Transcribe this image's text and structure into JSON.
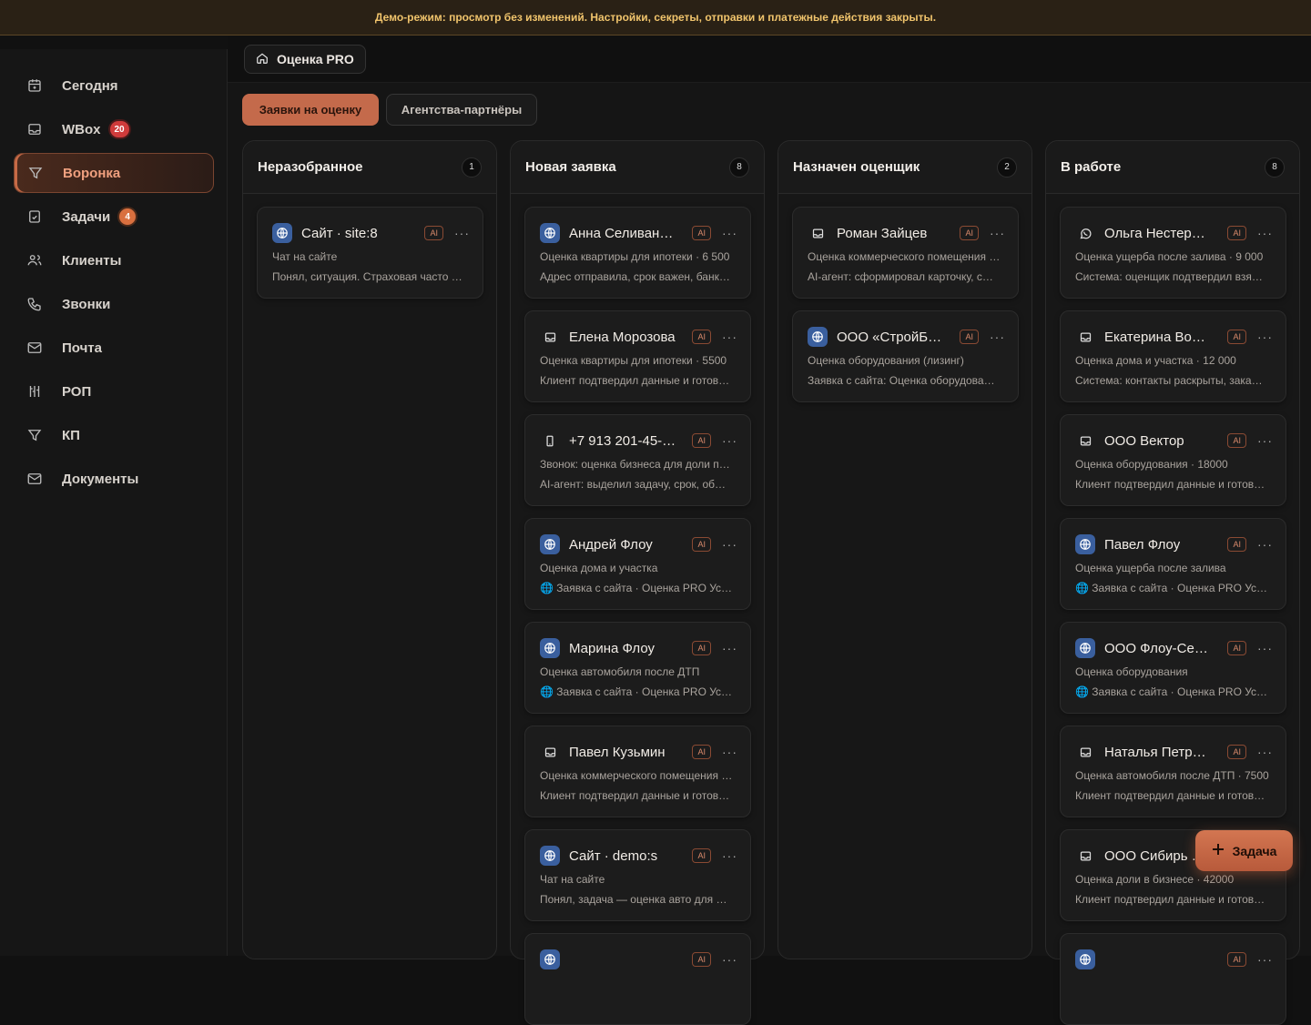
{
  "banner": "Демо-режим: просмотр без изменений. Настройки, секреты, отправки и платежные действия закрыты.",
  "sidebar": {
    "items": [
      {
        "label": "Сегодня",
        "icon": "calendar-icon"
      },
      {
        "label": "WBox",
        "icon": "inbox-icon",
        "badge": "20"
      },
      {
        "label": "Воронка",
        "icon": "funnel-icon",
        "active": true
      },
      {
        "label": "Задачи",
        "icon": "checklist-icon",
        "badge": "4"
      },
      {
        "label": "Клиенты",
        "icon": "users-icon"
      },
      {
        "label": "Звонки",
        "icon": "phone-icon"
      },
      {
        "label": "Почта",
        "icon": "mail-icon"
      },
      {
        "label": "РОП",
        "icon": "tools-icon"
      },
      {
        "label": "КП",
        "icon": "funnel-icon"
      },
      {
        "label": "Документы",
        "icon": "mail-icon"
      }
    ]
  },
  "breadcrumb": "Оценка PRO",
  "tabs": [
    "Заявки на оценку",
    "Агентства-партнёры"
  ],
  "ai_label": "AI",
  "dots": "···",
  "fab_label": "Задача",
  "columns": [
    {
      "title": "Неразобранное",
      "count": "1",
      "cards": [
        {
          "icon": "web",
          "name": "Сайт · site:8",
          "l1": "Чат на сайте",
          "l2": "Понял, ситуация. Страховая часто …"
        }
      ]
    },
    {
      "title": "Новая заявка",
      "count": "8",
      "cards": [
        {
          "icon": "web",
          "name": "Анна Селиван…",
          "l1": "Оценка квартиры для ипотеки · 6 500",
          "l2": "Адрес отправила, срок важен, банк…"
        },
        {
          "icon": "inbox",
          "name": "Елена Морозова",
          "l1": "Оценка квартиры для ипотеки · 5500",
          "l2": "Клиент подтвердил данные и готов…"
        },
        {
          "icon": "mobile",
          "name": "+7 913 201-45-…",
          "l1": "Звонок: оценка бизнеса для доли п…",
          "l2": "AI-агент: выделил задачу, срок, об…"
        },
        {
          "icon": "web",
          "name": "Андрей Флоу",
          "l1": "Оценка дома и участка",
          "l2": "🌐 Заявка с сайта · Оценка PRO Ус…"
        },
        {
          "icon": "web",
          "name": "Марина Флоу",
          "l1": "Оценка автомобиля после ДТП",
          "l2": "🌐 Заявка с сайта · Оценка PRO Ус…"
        },
        {
          "icon": "inbox",
          "name": "Павел Кузьмин",
          "l1": "Оценка коммерческого помещения …",
          "l2": "Клиент подтвердил данные и готов…"
        },
        {
          "icon": "web",
          "name": "Сайт · demo:s",
          "l1": "Чат на сайте",
          "l2": "Понял, задача — оценка авто для …"
        },
        {
          "icon": "web",
          "name": "",
          "l1": "",
          "l2": ""
        }
      ]
    },
    {
      "title": "Назначен оценщик",
      "count": "2",
      "cards": [
        {
          "icon": "inbox",
          "name": "Роман Зайцев",
          "l1": "Оценка коммерческого помещения …",
          "l2": "AI-агент: сформировал карточку, с…"
        },
        {
          "icon": "web",
          "name": "ООО «СтройБ…",
          "l1": "Оценка оборудования (лизинг)",
          "l2": "Заявка с сайта: Оценка оборудова…"
        }
      ]
    },
    {
      "title": "В работе",
      "count": "8",
      "cards": [
        {
          "icon": "whatsapp",
          "name": "Ольга Нестер…",
          "l1": "Оценка ущерба после залива · 9 000",
          "l2": "Система: оценщик подтвердил взя…"
        },
        {
          "icon": "inbox",
          "name": "Екатерина Во…",
          "l1": "Оценка дома и участка · 12 000",
          "l2": "Система: контакты раскрыты, зака…"
        },
        {
          "icon": "inbox",
          "name": "ООО Вектор",
          "l1": "Оценка оборудования · 18000",
          "l2": "Клиент подтвердил данные и готов…"
        },
        {
          "icon": "web",
          "name": "Павел Флоу",
          "l1": "Оценка ущерба после залива",
          "l2": "🌐 Заявка с сайта · Оценка PRO Ус…"
        },
        {
          "icon": "web",
          "name": "ООО Флоу-Се…",
          "l1": "Оценка оборудования",
          "l2": "🌐 Заявка с сайта · Оценка PRO Ус…"
        },
        {
          "icon": "inbox",
          "name": "Наталья Петр…",
          "l1": "Оценка автомобиля после ДТП · 7500",
          "l2": "Клиент подтвердил данные и готов…"
        },
        {
          "icon": "inbox",
          "name": "ООО Сибирь …",
          "l1": "Оценка доли в бизнесе · 42000",
          "l2": "Клиент подтвердил данные и готов…"
        },
        {
          "icon": "web",
          "name": "",
          "l1": "",
          "l2": ""
        }
      ]
    }
  ]
}
